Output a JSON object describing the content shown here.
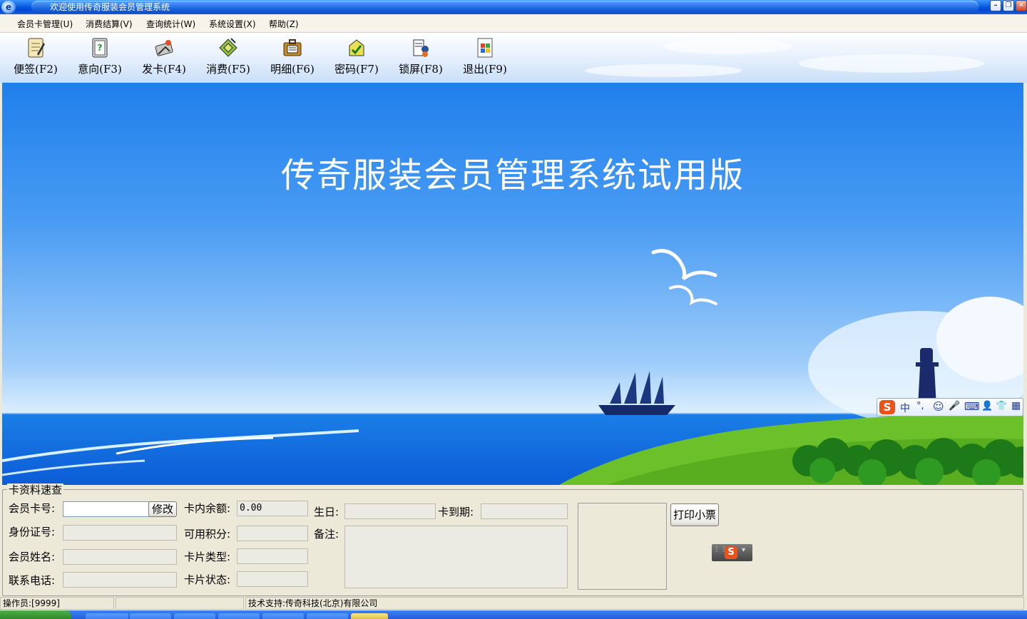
{
  "window": {
    "title": "欢迎使用传奇服装会员管理系统"
  },
  "menu": [
    {
      "label": "会员卡管理(U)"
    },
    {
      "label": "消费结算(V)"
    },
    {
      "label": "查询统计(W)"
    },
    {
      "label": "系统设置(X)"
    },
    {
      "label": "帮助(Z)"
    }
  ],
  "toolbar": [
    {
      "label": "便签(F2)",
      "icon": "notepad-icon"
    },
    {
      "label": "意向(F3)",
      "icon": "question-book-icon"
    },
    {
      "label": "发卡(F4)",
      "icon": "issue-card-icon"
    },
    {
      "label": "消费(F5)",
      "icon": "consume-icon"
    },
    {
      "label": "明细(F6)",
      "icon": "detail-briefcase-icon"
    },
    {
      "label": "密码(F7)",
      "icon": "password-key-icon"
    },
    {
      "label": "锁屏(F8)",
      "icon": "lock-screen-icon"
    },
    {
      "label": "退出(F9)",
      "icon": "exit-windows-icon"
    }
  ],
  "banner": {
    "title": "传奇服装会员管理系统试用版"
  },
  "ime_toolbar": {
    "items": [
      "中",
      "°,",
      "☺",
      "🎤",
      "⌨",
      "👤",
      "👕",
      "▦"
    ]
  },
  "quick_lookup": {
    "legend": "卡资料速查",
    "card_no_label": "会员卡号:",
    "card_no_value": "",
    "edit_button": "修改",
    "id_no_label": "身份证号:",
    "id_no_value": "",
    "name_label": "会员姓名:",
    "name_value": "",
    "phone_label": "联系电话:",
    "phone_value": "",
    "balance_label": "卡内余额:",
    "balance_value": "0.00",
    "points_label": "可用积分:",
    "points_value": "",
    "card_type_label": "卡片类型:",
    "card_type_value": "",
    "card_status_label": "卡片状态:",
    "card_status_value": "",
    "birthday_label": "生日:",
    "birthday_value": "",
    "expiry_label": "卡到期:",
    "expiry_value": "",
    "remark_label": "备注:",
    "remark_value": "",
    "print_button": "打印小票"
  },
  "statusbar": {
    "operator": "操作员:[9999]",
    "support": "技术支持:传奇科技(北京)有限公司"
  },
  "colors": {
    "titlebar": "#0a5fe0",
    "banner_sky": "#1f7fec",
    "panel_bg": "#ece9d8"
  }
}
